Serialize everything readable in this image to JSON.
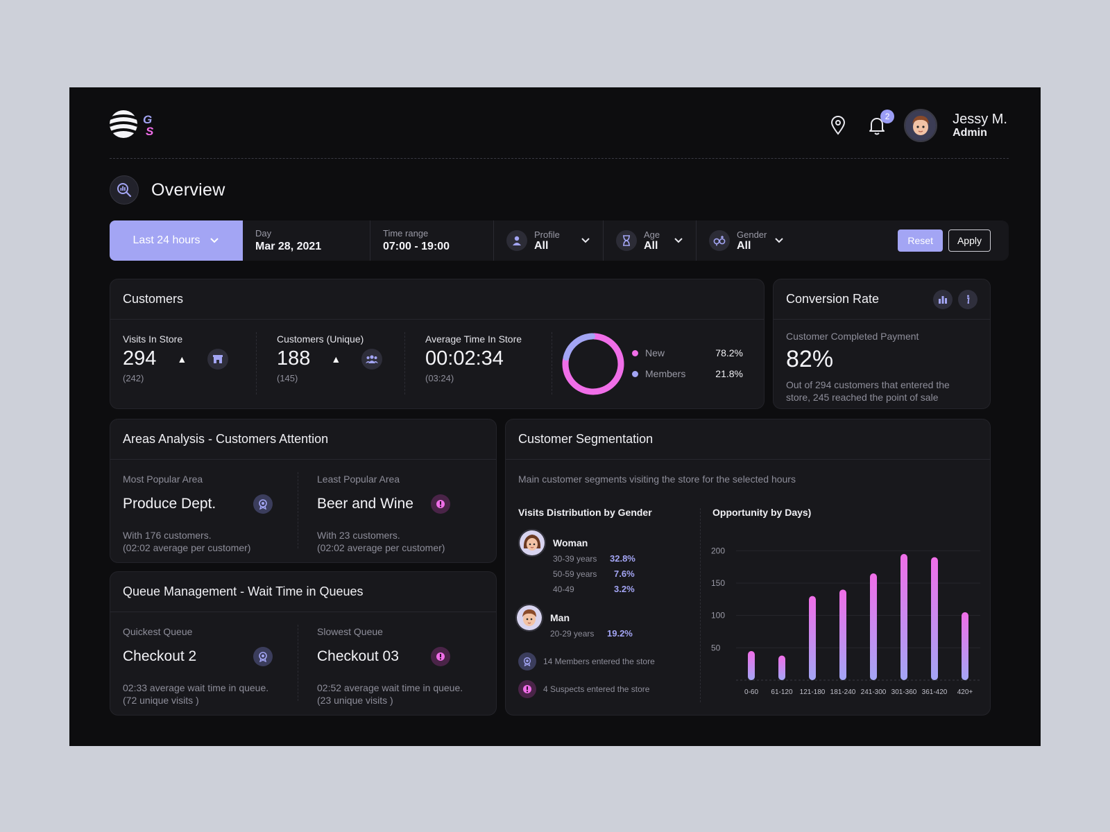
{
  "header": {
    "notifications_count": "2",
    "user": {
      "name": "Jessy M.",
      "role": "Admin"
    }
  },
  "page": {
    "title": "Overview"
  },
  "filters": {
    "range": "Last 24 hours",
    "day": {
      "label": "Day",
      "value": "Mar 28, 2021"
    },
    "time_range": {
      "label": "Time range",
      "value": "07:00 - 19:00"
    },
    "profile": {
      "label": "Profile",
      "value": "All"
    },
    "age": {
      "label": "Age",
      "value": "All"
    },
    "gender": {
      "label": "Gender",
      "value": "All"
    },
    "reset_label": "Reset",
    "apply_label": "Apply"
  },
  "customers": {
    "title": "Customers",
    "visits": {
      "label": "Visits In Store",
      "value": "294",
      "previous": "(242)"
    },
    "unique": {
      "label": "Customers (Unique)",
      "value": "188",
      "previous": "(145)"
    },
    "avg_time": {
      "label": "Average Time In Store",
      "value": "00:02:34",
      "previous": "(03:24)"
    },
    "breakdown": [
      {
        "name": "New",
        "pct": "78.2%",
        "value": 78.2,
        "color": "#f06ee8"
      },
      {
        "name": "Members",
        "pct": "21.8%",
        "value": 21.8,
        "color": "#a3a5f4"
      }
    ]
  },
  "conversion": {
    "title": "Conversion Rate",
    "label": "Customer Completed Payment",
    "value": "82%",
    "desc": "Out of 294 customers that entered the store, 245 reached the point of sale"
  },
  "areas": {
    "title": "Areas Analysis - Customers Attention",
    "most": {
      "label": "Most Popular Area",
      "name": "Produce Dept.",
      "line1": "With 176 customers.",
      "line2": "(02:02 average per customer)"
    },
    "least": {
      "label": "Least Popular Area",
      "name": "Beer and Wine",
      "line1": "With 23 customers.",
      "line2": "(02:02 average per customer)"
    }
  },
  "queue": {
    "title": "Queue Management - Wait Time in Queues",
    "quickest": {
      "label": "Quickest Queue",
      "name": "Checkout 2",
      "line1": "02:33 average wait time in queue.",
      "line2": "(72 unique visits )"
    },
    "slowest": {
      "label": "Slowest Queue",
      "name": "Checkout 03",
      "line1": "02:52 average wait time in queue.",
      "line2": "(23 unique visits )"
    }
  },
  "segmentation": {
    "title": "Customer Segmentation",
    "subtitle": "Main customer segments visiting the store for the selected hours",
    "gender_title": "Visits Distribution by Gender",
    "woman": {
      "label": "Woman",
      "ages": [
        {
          "range": "30-39 years",
          "pct": "32.8%"
        },
        {
          "range": "50-59 years",
          "pct": "7.6%"
        },
        {
          "range": "40-49",
          "pct": "3.2%"
        }
      ]
    },
    "man": {
      "label": "Man",
      "ages": [
        {
          "range": "20-29 years",
          "pct": "19.2%"
        }
      ]
    },
    "members_note": "14 Members entered the store",
    "suspects_note": "4 Suspects entered the store",
    "chart_title": "Opportunity by Days)"
  },
  "colors": {
    "accent": "#a3a5f4",
    "pink": "#f06ee8",
    "bg": "#0d0d0f",
    "card": "#18181c"
  },
  "chart_data": [
    {
      "type": "bar",
      "title": "Opportunity by Days)",
      "categories": [
        "0-60",
        "61-120",
        "121-180",
        "181-240",
        "241-300",
        "301-360",
        "361-420",
        "420+"
      ],
      "values": [
        45,
        38,
        130,
        140,
        165,
        195,
        190,
        105
      ],
      "ylim": [
        0,
        210
      ],
      "yticks": [
        50,
        100,
        150,
        200
      ],
      "grid": true
    },
    {
      "type": "pie",
      "categories": [
        "New",
        "Members"
      ],
      "values": [
        78.2,
        21.8
      ]
    }
  ]
}
